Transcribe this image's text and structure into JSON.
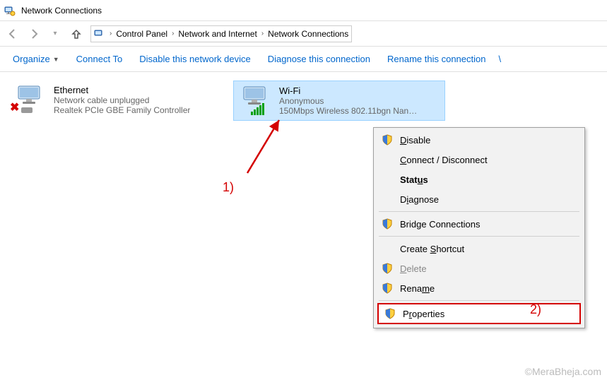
{
  "window": {
    "title": "Network Connections"
  },
  "breadcrumb": {
    "items": [
      "Control Panel",
      "Network and Internet",
      "Network Connections"
    ]
  },
  "toolbar": {
    "organize": "Organize",
    "connect_to": "Connect To",
    "disable": "Disable this network device",
    "diagnose": "Diagnose this connection",
    "rename": "Rename this connection"
  },
  "connections": [
    {
      "name": "Ethernet",
      "status": "Network cable unplugged",
      "device": "Realtek PCIe GBE Family Controller",
      "selected": false,
      "has_error": true
    },
    {
      "name": "Wi-Fi",
      "status": "Anonymous",
      "device": "150Mbps Wireless 802.11bgn Nan…",
      "selected": true,
      "has_signal": true
    }
  ],
  "context_menu": {
    "disable": "Disable",
    "connect_disconnect": "Connect / Disconnect",
    "status": "Status",
    "diagnose": "Diagnose",
    "bridge": "Bridge Connections",
    "create_shortcut": "Create Shortcut",
    "delete": "Delete",
    "rename": "Rename",
    "properties": "Properties"
  },
  "annotations": {
    "label1": "1)",
    "label2": "2)"
  },
  "watermark": "©MeraBheja.com"
}
